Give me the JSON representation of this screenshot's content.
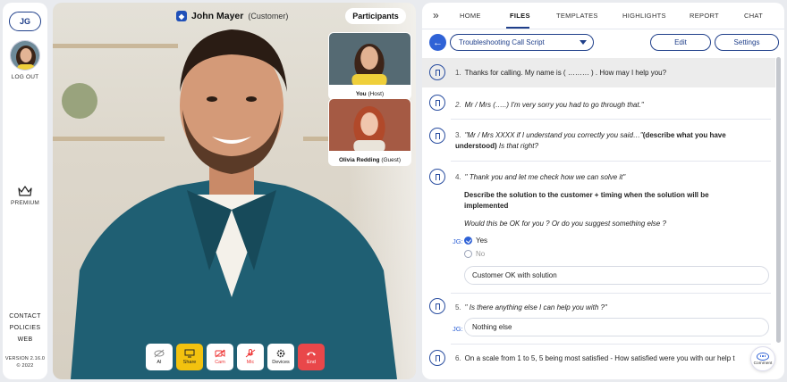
{
  "sidebar": {
    "user_initials": "JG",
    "logout_label": "LOG OUT",
    "premium_label": "PREMIUM",
    "links": [
      "CONTACT",
      "POLICIES",
      "WEB"
    ],
    "version": "VERSION 2.16.0",
    "copyright": "© 2022"
  },
  "video": {
    "caller_name": "John Mayer",
    "caller_role": "(Customer)",
    "participants_label": "Participants",
    "thumbnails": [
      {
        "name": "You",
        "role": "(Host)"
      },
      {
        "name": "Olivia Redding",
        "role": "(Guest)"
      }
    ],
    "controls": [
      {
        "label": "AI",
        "icon": "ai-off-icon"
      },
      {
        "label": "Share",
        "icon": "screen-share-icon"
      },
      {
        "label": "Cam",
        "icon": "camera-off-icon"
      },
      {
        "label": "Mic",
        "icon": "mic-off-icon"
      },
      {
        "label": "Devices",
        "icon": "gear-icon"
      },
      {
        "label": "End",
        "icon": "phone-hangup-icon"
      }
    ]
  },
  "panel": {
    "tabs": [
      "HOME",
      "FILES",
      "TEMPLATES",
      "HIGHLIGHTS",
      "REPORT",
      "CHAT"
    ],
    "active_tab": "FILES",
    "script_name": "Troubleshooting Call Script",
    "edit_label": "Edit",
    "settings_label": "Settings",
    "items": [
      {
        "num": "1.",
        "text": "Thanks for calling. My name is ( ……… ) . How may I help you?"
      },
      {
        "num": "2.",
        "text": "Mr / Mrs (…..) I'm very sorry you had to go through that.\""
      },
      {
        "num": "3.",
        "text_a": "\"Mr / Mrs XXXX if I understand you correctly you said…\"",
        "text_b": "(describe what you have understood)",
        "text_c": "Is that right?"
      },
      {
        "num": "4.",
        "text": "\" Thank you and let me check how we can solve it\"",
        "bold": "Describe the solution to the customer + timing when the solution will be implemented",
        "question": "Would this be OK for you ? Or do you suggest something else ?",
        "tag": "JG:",
        "opt_yes": "Yes",
        "opt_no": "No",
        "note": "Customer OK with solution"
      },
      {
        "num": "5.",
        "text": "\" Is there anything else I can help you with ?\"",
        "tag": "JG:",
        "note": "Nothing else"
      },
      {
        "num": "6.",
        "text": "On a scale from 1 to 5, 5 being most satisfied - How satisfied were you with our help t"
      }
    ],
    "comment_label": "Comment"
  }
}
